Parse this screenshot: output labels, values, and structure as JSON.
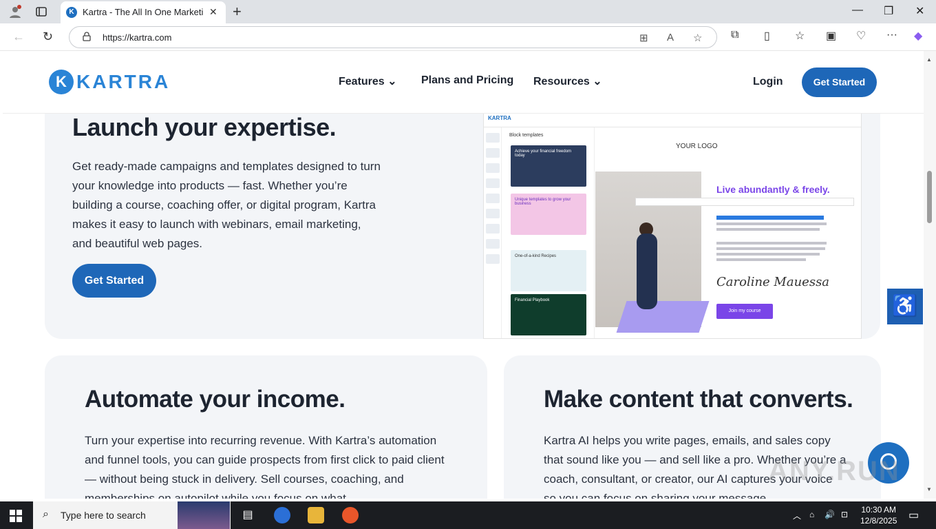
{
  "browser": {
    "tab_title": "Kartra - The All In One Marketing",
    "tab_favicon": "K",
    "url": "https://kartra.com"
  },
  "site": {
    "logo_mark": "K",
    "logo_text": "KARTRA",
    "nav": [
      {
        "label": "Features",
        "has_dropdown": true
      },
      {
        "label": "Plans and Pricing",
        "has_dropdown": false
      },
      {
        "label": "Resources",
        "has_dropdown": true
      }
    ],
    "login": "Login",
    "cta": "Get Started",
    "accent": "#1e67b8"
  },
  "hero": {
    "title": "Launch your expertise.",
    "body": "Get ready-made campaigns and templates designed to turn your knowledge into products — fast. Whether you’re building a course, coaching offer, or digital program, Kartra makes it easy to launch with webinars, email marketing, and beautiful web pages.",
    "cta": "Get Started",
    "mock": {
      "brand": "KARTRA",
      "panel_title": "Block templates",
      "thumb1": "Achieve your financial freedom today",
      "thumb2": "Unique templates to grow your business",
      "thumb3": "One-of-a-kind Recipes",
      "thumb4": "Financial Playbook",
      "your_logo": "YOUR LOGO",
      "headline": "Live abundantly & freely.",
      "signature": "Caroline Mauessa",
      "join_button": "Join my course"
    }
  },
  "cards": [
    {
      "title": "Automate your income.",
      "body": "Turn your expertise into recurring revenue. With Kartra’s automation and funnel tools, you can guide prospects from first click to paid client — without being stuck in delivery. Sell courses, coaching, and memberships on autopilot while you focus on what"
    },
    {
      "title": "Make content that converts.",
      "body": "Kartra AI helps you write pages, emails, and sales copy that sound like you — and sell like a pro. Whether you’re a coach, consultant, or creator, our AI captures your voice so you can focus on sharing your message"
    }
  ],
  "watermark": "ANY.RUN",
  "taskbar": {
    "search_placeholder": "Type here to search",
    "time": "10:30 AM",
    "date": "12/8/2025"
  }
}
